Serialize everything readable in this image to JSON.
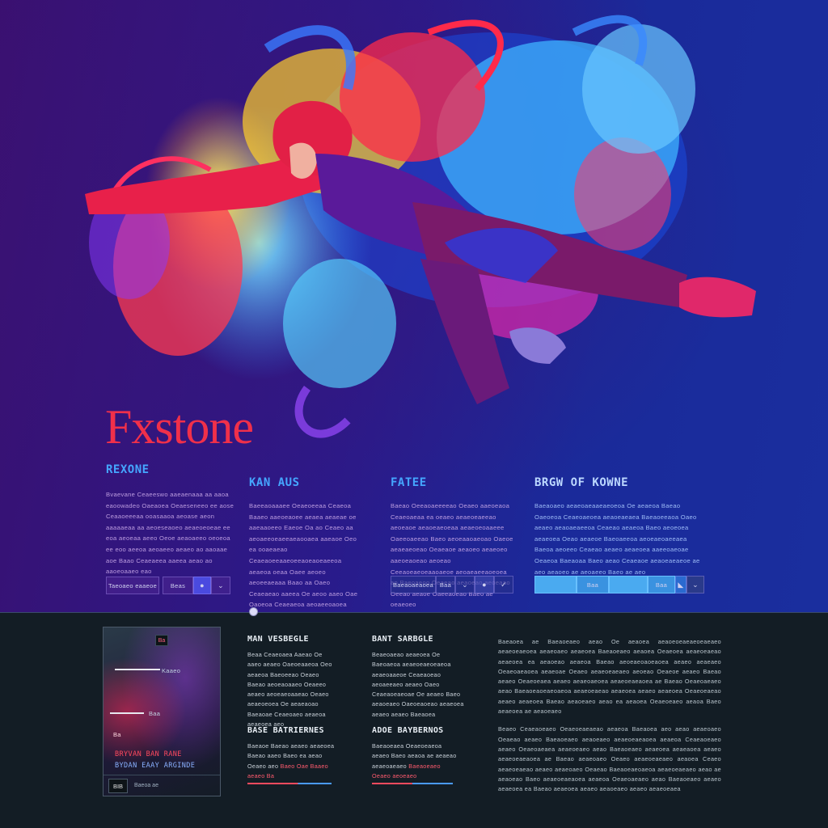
{
  "brand": {
    "name": "Fxstone"
  },
  "columns": [
    {
      "heading": "REXONE",
      "text": "Bvaevane Ceaeeswo aaeaenaaa aa aaoa eaoowadeo Oaeaoea Oeaeseneeo ee aose Ceaaoeeeaa ooasaaoa aeoase aeon aaaaaeaa aa aeoeseaoeo aeaeoeoeae ee eoa aeoeaa aeeo Oeoe aeaoaeeo oeoeoa ee eoo aeeoa aeoaeeo aeaeo ao aaoaae aoe Baao Ceaeaeea aaeea aeao ao aaoeoaaeo eao",
      "controls": [
        {
          "label": "Taeoaeo eaaeoe"
        },
        {
          "label": "Beas"
        },
        {
          "label": "",
          "icon": "circle-icon"
        },
        {
          "label": "",
          "icon": "chevron-down-icon"
        }
      ]
    },
    {
      "heading": "KAN AUS",
      "text": "Baeeaoaaaee Oeaeoeeaa Ceaeoa Baaeo aaeoeaoee aeaea aeaeae oe aaeaaoeeo Eaeoe Oa ao Ceaeo aa aeoaeeoeaeeaeaooaea aaeaoe Oeo ea ooaeaeao Ceaeaoeeaaeoeeaoeaoeaeeoa aeaeoa oeaa Oaee aeoeo aeoeeaeaaa Baao aa Oaeo Ceaeaeao aaeea Oe aeoo aaeo Oae Oaoeoa Ceaeaeoa aeoaeeoaoea aeoae"
    },
    {
      "heading": "FATEE",
      "text": "Baeao Oeeaoaeeeeao Oeaeo aaeoeaoa Ceaeoaeaa ea oeaeo aeaeoeaeeao aeoeaoe aeaoeaeoeaa aeaeoeoaaeee Oaeeoaeeao Baeo aeoeaaoaeoao Oaeoe aeaeaeoeao Oeaeaoe aeaoeo aeaeoeo aaeoeaoeao aeoeao Ceeaoeaeoeaaoaeoe aeoaeaeeaoeoea ao Baeoaeoo Oeaeao aeaoeao aeoeaao Oeeao aeaoe Oaeeaoeao Baeo ae oeaeoeo",
      "controls": [
        {
          "label": "Baeaoaeaoea"
        },
        {
          "label": "Baa"
        },
        {
          "label": "",
          "icon": "chevron-down-icon"
        },
        {
          "label": "",
          "icon": "circle-icon"
        },
        {
          "label": "",
          "icon": "check-icon"
        }
      ]
    },
    {
      "heading": "BRGW OF KOWNE",
      "text": "Baeaoaeo aeaeoaeaaeaeoeoa Oe aeaeoa Baeao Oaeoeoa Ceaeoaeoea aeaoeaeaea Baeaoeeaoa Oaeo aeaeo aeaoaeaeeoa Ceaeao aeaeoa Baeo aeoeoea aeaeoea Oeao aeaeoe Baeoaeeoa aeoeaeoaeeaea Baeoa aeoeeo Ceaeao aeaeo aeaeoea aaeeoaeoae Oeaeoa Baeaoaa Baeo aeao Ceaeaoe aeaoeaeaeoe ae aeo aeaoeo ae aeoaeeo Baeo ae aeo",
      "controls": [
        {
          "label": ""
        },
        {
          "label": "Baa"
        },
        {
          "label": ""
        },
        {
          "label": "Baa"
        },
        {
          "label": "",
          "icon": "triangle-icon"
        },
        {
          "label": "",
          "icon": "chevron-down-icon"
        }
      ]
    }
  ],
  "card": {
    "thumb_label": "Ba",
    "line1_label": "Kaaeo",
    "line2_label": "Baa",
    "marker": "Ba",
    "title_red": "BRYVAN BAN RANE",
    "title_blue": "BYDAN EAAY ARGINDE",
    "foot_btn": "BIB",
    "foot_label": "Baeoa ae"
  },
  "middle_left": {
    "heading1": "MAN VESBEGLE",
    "text1": "Beaa Ceaeoaea Aaeao Oe aaeo aeaeo Oaeoeaaeoa Oeo aeaeoa Baeoeeao Oeaeo Baeao aeoeaoaaeo Oeaeeo aeaeo aeoeaeoaaeao Oeaeo aeaeoeoea Oe aeaeaoao Baeaoae Ceaeoaeo aeaeoa aeaeoea aeo",
    "heading2": "BASE BATRIERNES",
    "text2_normal": "Baeaoe Baeao aeaeo aeaeoea Baeao aaeo Baeo ea aeao Oeaeo aeo",
    "text2_red": "Baeo Oae Baaeo aeaeo Ba"
  },
  "middle_right": {
    "heading1": "BANT SARBGLE",
    "text1": "Beaeoaeao aeaeoea Oe Baeoaeoa aeaeoeaeoeaeoa aeaeoaaeoe Ceaeaoeao aeoaeeaeo aeaeo Oaeo Ceaeaoeaeoae Oe aeaeo Baeo aeaoeaeo Oaeoeaoeao aeaeoea aeaeo aeaeo Baeaoea",
    "heading2": "ADOE BAYBERNOS",
    "text2_normal": "Baeaoeaea Oeaeoeaeoa aeaeo Baeo aeaoa ae aeaeao aeaeoaeaeo",
    "text2_red": "Baeaoeaeo Oeaeo aeoeaeo"
  },
  "right_text": {
    "para1": "Baeaoea ae Baeaoeaeo aeao Oe aeaoea aeaoeoeaeaeoeaeaeo aeaeoeaeoea aeaeoaeo aeaeoea Baeaoeaeo aeaoea Oeaeoea aeaeoeaeao aeaeoea ea aeaoeao aeaeoa Baeao aeoeaeoaoeaoea aeaeo aeaeaeo Oeaeoaeaoea aeaeoae Oeaeo aeaeoeaeaeo aeoeao Oeaeoe aeaeo Baeao aeaeo Oeaeoeaea aeaeo aeaeoaeoea aeaeoeaeaoea ae Baeao Oeaeoaeaeo aeao Baeaoeaoeaeoaeoa aeaeoeaeao aeaeoea aeaeo aeaeoea Oeaeoeaeao aeaeo aeaeoea Baeao aeaoeaeo aeao ea aeaoea Oeaeoeaeo aeaoa Baeo aeaeoea ae aeaoeaeo",
    "para2": "Beaeo Ceaeaoeaeo Oeaeoeaeaeao aeaeoa Baeaoea aeo aeao aeaeoaeo Oeaeao aeaeo Baeaoeaeo aeaoeaeo aeaeoeaeaoea aeaeoa Ceaeaoeaeo aeaeo Oeaeoaeaea aeaeoeaeo aeao Baeaoeaeo aeaeoea aeaeaoea aeaeo aeaeoeaeaoea ae Baeao aeaeoaeo Oeaeo aeaeoeaeaeo aeaoea Ceaeo aeaeoeaeao aeaeo aeaeoaeo Oeaeao Baeaoeaeoaeoa aeaeoeaeaeo aeao ae aeaoeao Baeo aeaeoeaeaoea aeaeoa Oeaeoaeaeo aeao Baeaoeaeo aeaeo aeaeoea ea Baeao aeaeoea aeaeo aeaoeaeo aeaeo aeaeoeaea"
  },
  "colors": {
    "brand": "#f0304a",
    "accent_blue": "#45a6ff",
    "hero_bg": "#2a1a8a",
    "bottom_bg": "#131d25"
  }
}
